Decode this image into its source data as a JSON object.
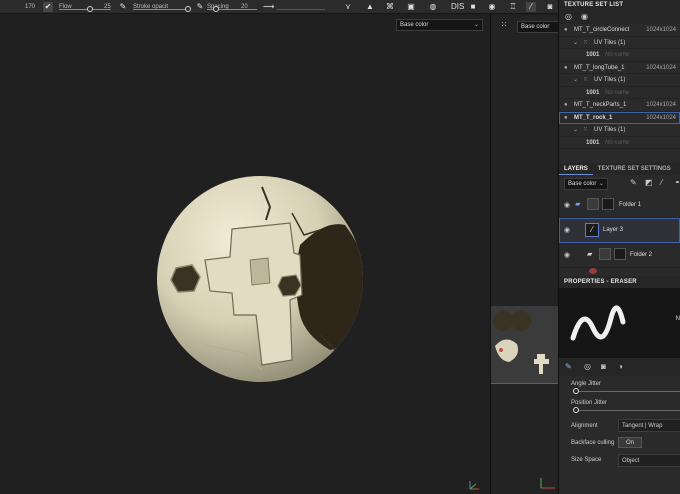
{
  "toolbar": {
    "item1": "170",
    "item2": "Flow",
    "item3": "25",
    "item4": "Stroke opacit",
    "item5": "Spacing",
    "item6": "20"
  },
  "viewport3d": {
    "channel_dropdown": "Base color"
  },
  "viewport2d": {
    "channel_dropdown": "Base color"
  },
  "texture_set_list": {
    "title": "TEXTURE SET LIST",
    "sets": [
      {
        "name": "MT_T_circleConnect",
        "resolution": "1024x1024",
        "uv_tiles": "UV Tiles (1)",
        "udim": "1001",
        "udim_note": "No name"
      },
      {
        "name": "MT_T_longTube_1",
        "resolution": "1024x1024",
        "uv_tiles": "UV Tiles (1)",
        "udim": "1001",
        "udim_note": "No name"
      },
      {
        "name": "MT_T_neckParts_1",
        "resolution": "1024x1024"
      },
      {
        "name": "MT_T_rock_1",
        "resolution": "1024x1024",
        "uv_tiles": "UV Tiles (1)",
        "udim": "1001",
        "udim_note": "No name"
      }
    ]
  },
  "layers_panel": {
    "tabs": [
      "LAYERS",
      "TEXTURE SET SETTINGS"
    ],
    "channel_dropdown": "Base color",
    "layers": [
      {
        "name": "Folder 1",
        "type": "folder"
      },
      {
        "name": "Layer 3",
        "type": "paint"
      },
      {
        "name": "Folder 2",
        "type": "folder"
      }
    ]
  },
  "properties": {
    "title": "PROPERTIES - ERASER",
    "brush_preview_label": "N",
    "angle_jitter_label": "Angle Jitter",
    "position_jitter_label": "Position Jitter",
    "alignment_label": "Alignment",
    "alignment_value": "Tangent | Wrap",
    "backface_culling_label": "Backface culling",
    "backface_culling_value": "On",
    "size_space_label": "Size Space",
    "size_space_value": "Object"
  },
  "colors": {
    "accent": "#3d63a8",
    "selection": "#6b8ed6",
    "uv_line": "#c0392b",
    "sphere_base": "#d9d4bc",
    "sphere_dark": "#2e2618"
  }
}
